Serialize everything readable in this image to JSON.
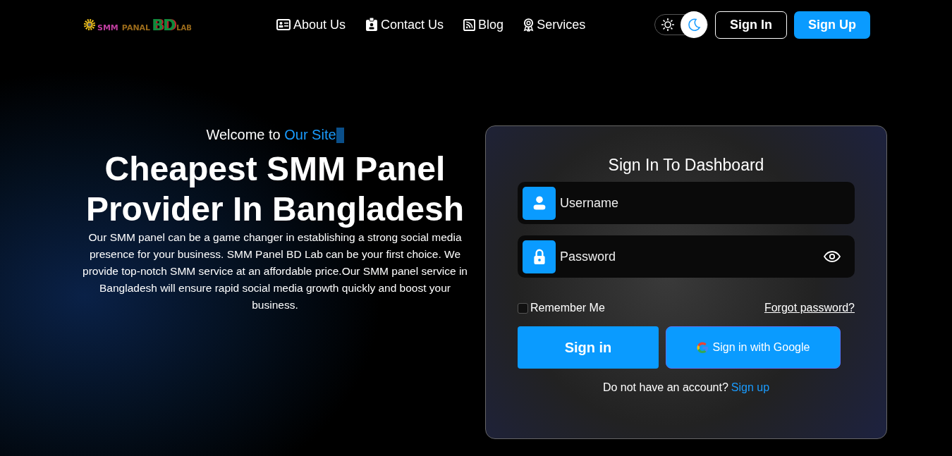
{
  "logo": {
    "parts": [
      "SMM",
      "PANAL",
      "BD",
      "LAB"
    ]
  },
  "nav": [
    {
      "label": "About Us"
    },
    {
      "label": "Contact Us"
    },
    {
      "label": "Blog"
    },
    {
      "label": "Services"
    }
  ],
  "theme_toggle": {
    "dark": true
  },
  "header_buttons": [
    {
      "label": "Sign In",
      "kind": "outline"
    },
    {
      "label": "Sign Up",
      "kind": "filled"
    }
  ],
  "hero": {
    "welcome": "Welcome to ",
    "highlight": "Our Site",
    "title": "Cheapest SMM Panel Provider In Bangladesh",
    "text": "Our SMM panel can be a game changer in establishing a strong social media presence for your business. SMM Panel BD Lab can be your first choice. We provide top-notch SMM service at an affordable price.Our SMM panel service in Bangladesh will ensure rapid social media growth quickly and boost your business."
  },
  "login": {
    "title": "Sign In To Dashboard",
    "fields": [
      {
        "placeholder": "Username",
        "kind": "user"
      },
      {
        "placeholder": "Password",
        "kind": "password"
      }
    ],
    "remember": {
      "label": "Remember Me",
      "checked": false
    },
    "forgot": "Forgot password?",
    "sign_in": "Sign in",
    "google": "Sign in with Google",
    "signup_prompt": "Do not have an account?",
    "signup_link": "Sign up"
  }
}
